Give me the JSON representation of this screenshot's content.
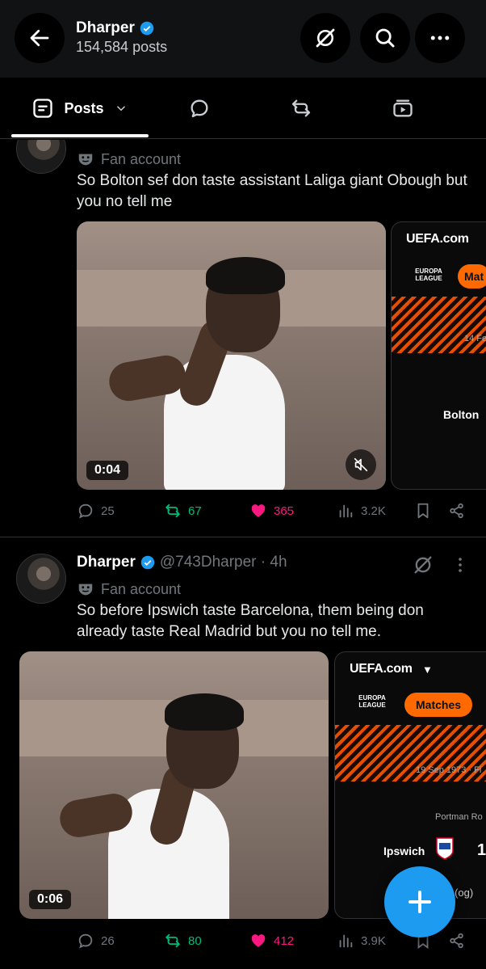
{
  "header": {
    "name": "Dharper",
    "post_count": "154,584 posts",
    "back_icon": "arrow-left-icon",
    "grok_icon": "grok-icon",
    "search_icon": "search-icon",
    "more_icon": "more-horizontal-icon"
  },
  "tabs": [
    {
      "label": "Posts",
      "icon": "posts-icon",
      "selected": true
    },
    {
      "label": "",
      "icon": "reply-icon"
    },
    {
      "label": "",
      "icon": "retweet-icon"
    },
    {
      "label": "",
      "icon": "media-icon"
    }
  ],
  "posts": [
    {
      "tag": "Fan account",
      "text": "So Bolton sef don taste assistant Laliga giant Obough but you no tell me",
      "video_duration": "0:04",
      "card": {
        "site": "UEFA.com",
        "league_line1": "EUROPA",
        "league_line2": "LEAGUE",
        "pill": "Mat",
        "date": "14 Fe",
        "team": "Bolton"
      },
      "stats": {
        "replies": "25",
        "reposts": "67",
        "likes": "365",
        "views": "3.2K"
      }
    },
    {
      "name": "Dharper",
      "handle": "@743Dharper · 4h",
      "tag": "Fan account",
      "text": "So before Ipswich taste Barcelona, them being don already taste Real Madrid but you no tell me.",
      "video_duration": "0:06",
      "card": {
        "site": "UEFA.com",
        "league_line1": "EUROPA",
        "league_line2": "LEAGUE",
        "pill": "Matches",
        "date": "19 Sep 1973 · Fi",
        "venue": "Portman Ro",
        "team": "Ipswich",
        "score": "1",
        "note": "' (og)"
      },
      "stats": {
        "replies": "26",
        "reposts": "80",
        "likes": "412",
        "views": "3.9K"
      }
    }
  ],
  "colors": {
    "accent": "#1d9bf0",
    "repost": "#00ba7c",
    "like": "#f91880",
    "uefa_orange": "#ff6a00"
  }
}
